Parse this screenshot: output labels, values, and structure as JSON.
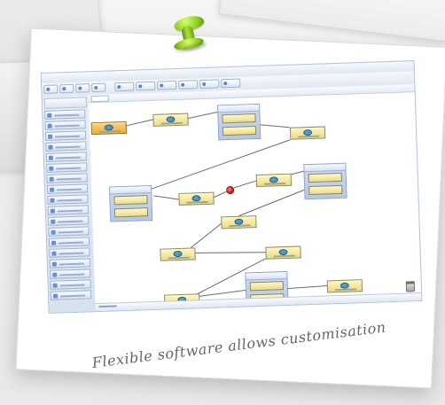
{
  "photo": {
    "caption": "Flexible software allows customisation"
  },
  "icons": {
    "pin": "pushpin-icon",
    "trash": "trash-icon",
    "node": "workflow-node-icon",
    "stop": "stop-icon"
  },
  "colors": {
    "pin": "#8cca1a",
    "node": "#eadb89",
    "group": "#b6c7e5",
    "caption": "#666666"
  }
}
